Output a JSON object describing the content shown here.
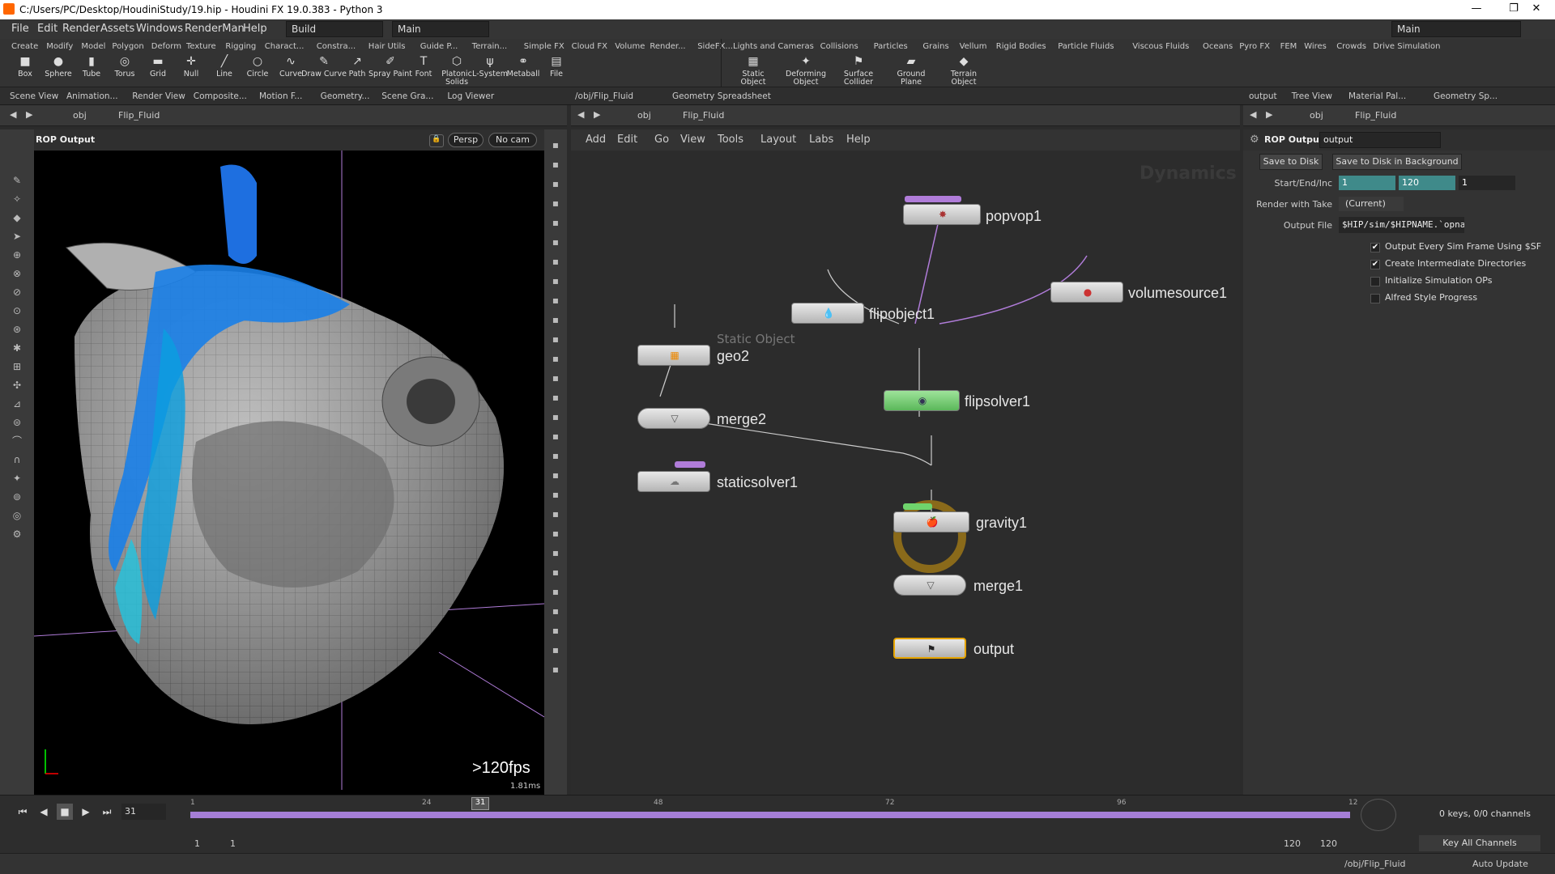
{
  "window": {
    "title": "C:/Users/PC/Desktop/HoudiniStudy/19.hip - Houdini FX 19.0.383 - Python 3",
    "minimize": "—",
    "maximize": "❐",
    "close": "✕"
  },
  "menubar": {
    "items": [
      "File",
      "Edit",
      "Render",
      "Assets",
      "Windows",
      "RenderMan",
      "Help"
    ],
    "desktop_left": "Build",
    "desktop_mid": "Main",
    "desktop_right": "Main"
  },
  "shelf_left": {
    "tabs": [
      "Create",
      "Modify",
      "Model",
      "Polygon",
      "Deform",
      "Texture",
      "Rigging",
      "Charact...",
      "Constra...",
      "Hair Utils",
      "Guide P...",
      "Terrain...",
      "Simple FX",
      "Cloud FX",
      "Volume",
      "Render...",
      "SideFX..."
    ],
    "tools": [
      {
        "label": "Box",
        "icon": "box-icon",
        "glyph": "■"
      },
      {
        "label": "Sphere",
        "icon": "sphere-icon",
        "glyph": "●"
      },
      {
        "label": "Tube",
        "icon": "tube-icon",
        "glyph": "▮"
      },
      {
        "label": "Torus",
        "icon": "torus-icon",
        "glyph": "◎"
      },
      {
        "label": "Grid",
        "icon": "grid-icon",
        "glyph": "▬"
      },
      {
        "label": "Null",
        "icon": "null-icon",
        "glyph": "✛"
      },
      {
        "label": "Line",
        "icon": "line-icon",
        "glyph": "╱"
      },
      {
        "label": "Circle",
        "icon": "circle-icon",
        "glyph": "○"
      },
      {
        "label": "Curve",
        "icon": "curve-icon",
        "glyph": "∿"
      },
      {
        "label": "Draw Curve",
        "icon": "draw-curve-icon",
        "glyph": "✎"
      },
      {
        "label": "Path",
        "icon": "path-icon",
        "glyph": "↗"
      },
      {
        "label": "Spray Paint",
        "icon": "spray-paint-icon",
        "glyph": "✐"
      },
      {
        "label": "Font",
        "icon": "font-icon",
        "glyph": "T"
      },
      {
        "label": "Platonic Solids",
        "icon": "platonic-icon",
        "glyph": "⬡"
      },
      {
        "label": "L-System",
        "icon": "lsystem-icon",
        "glyph": "ψ"
      },
      {
        "label": "Metaball",
        "icon": "metaball-icon",
        "glyph": "⚭"
      },
      {
        "label": "File",
        "icon": "file-icon",
        "glyph": "▤"
      }
    ]
  },
  "shelf_right": {
    "tabs": [
      "Lights and Cameras",
      "Collisions",
      "Particles",
      "Grains",
      "Vellum",
      "Rigid Bodies",
      "Particle Fluids",
      "Viscous Fluids",
      "Oceans",
      "Pyro FX",
      "FEM",
      "Wires",
      "Crowds",
      "Drive Simulation"
    ],
    "tools": [
      {
        "label": "Static Object",
        "icon": "static-object-icon",
        "glyph": "▦"
      },
      {
        "label": "Deforming Object",
        "icon": "deforming-object-icon",
        "glyph": "✦"
      },
      {
        "label": "Surface Collider",
        "icon": "surface-collider-icon",
        "glyph": "⚑"
      },
      {
        "label": "Ground Plane",
        "icon": "ground-plane-icon",
        "glyph": "▰"
      },
      {
        "label": "Terrain Object",
        "icon": "terrain-object-icon",
        "glyph": "◆"
      }
    ]
  },
  "left_tabs": [
    "Scene View",
    "Animation...",
    "Render View",
    "Composite...",
    "Motion F...",
    "Geometry...",
    "Scene Gra...",
    "Log Viewer"
  ],
  "mid_tabs": [
    "/obj/Flip_Fluid",
    "Geometry Spreadsheet"
  ],
  "right_tabs": [
    "output",
    "Tree View",
    "Material Pal...",
    "Geometry Sp..."
  ],
  "viewport": {
    "path_root": "obj",
    "path_node": "Flip_Fluid",
    "title": "ROP Output",
    "persp": "Persp",
    "cam": "No cam",
    "fps": ">120fps",
    "ms": "1.81ms"
  },
  "network": {
    "path_root": "obj",
    "path_node": "Flip_Fluid",
    "menus": [
      "Add",
      "Edit",
      "Go",
      "View",
      "Tools",
      "Layout",
      "Labs",
      "Help"
    ],
    "watermark": "Dynamics",
    "static_label": "Static Object",
    "nodes": [
      "popvop1",
      "flipobject1",
      "volumesource1",
      "geo2",
      "merge2",
      "staticsolver1",
      "flipsolver1",
      "gravity1",
      "merge1",
      "output"
    ]
  },
  "params": {
    "path_root": "obj",
    "path_node": "Flip_Fluid",
    "type": "ROP Output",
    "name": "output",
    "save_disk": "Save to Disk",
    "save_bg": "Save to Disk in Background",
    "start_label": "Start/End/Inc",
    "start": "1",
    "end": "120",
    "inc": "1",
    "take_label": "Render with Take",
    "take": "(Current)",
    "file_label": "Output File",
    "file": "$HIP/sim/$HIPNAME.`opnam",
    "checks": [
      {
        "label": "Output Every Sim Frame Using $SF",
        "checked": true
      },
      {
        "label": "Create Intermediate Directories",
        "checked": true
      },
      {
        "label": "Initialize Simulation OPs",
        "checked": false
      },
      {
        "label": "Alfred Style Progress",
        "checked": false
      }
    ]
  },
  "timeline": {
    "frame": "31",
    "marker": "31",
    "ticks": [
      "1",
      "24",
      "48",
      "72",
      "96",
      "12"
    ],
    "range_start": "1",
    "range_start2": "1",
    "range_end": "120",
    "range_end2": "120",
    "keys": "0 keys, 0/0 channels",
    "key_all": "Key All Channels"
  },
  "status": {
    "path": "/obj/Flip_Fluid",
    "update": "Auto Update"
  }
}
